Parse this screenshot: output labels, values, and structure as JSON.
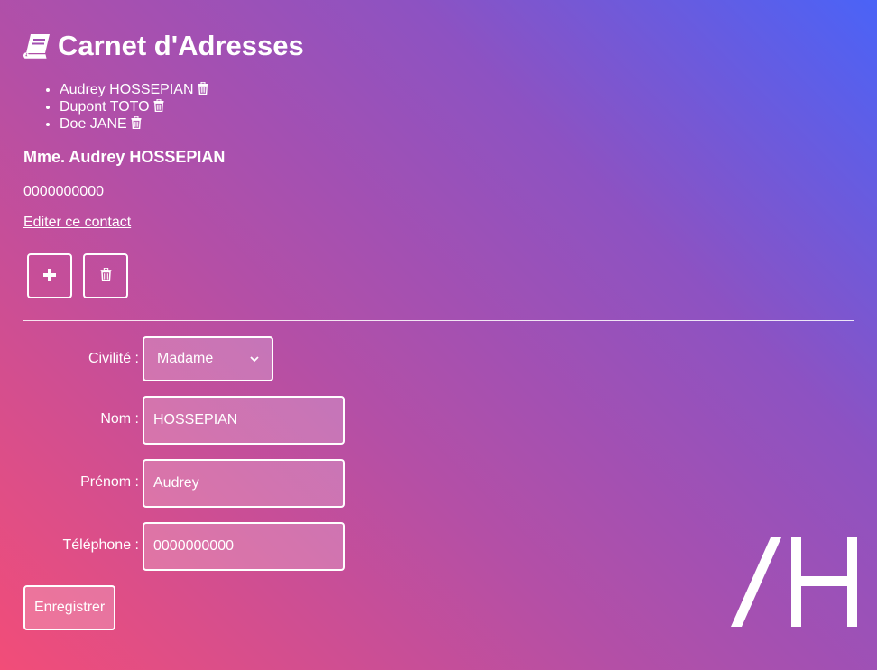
{
  "app": {
    "title": "Carnet d'Adresses",
    "title_icon": "book-icon"
  },
  "contacts": [
    {
      "label": "Audrey HOSSEPIAN",
      "action_icon": "trash-icon"
    },
    {
      "label": "Dupont TOTO",
      "action_icon": "trash-icon"
    },
    {
      "label": "Doe JANE",
      "action_icon": "trash-icon"
    }
  ],
  "selected_contact": {
    "heading": "Mme. Audrey HOSSEPIAN",
    "phone": "0000000000",
    "edit_link": "Editer ce contact"
  },
  "toolbar": {
    "add_icon": "plus-icon",
    "delete_icon": "trash-icon"
  },
  "form": {
    "civilite_label": "Civilité :",
    "civilite_value": "Madame",
    "nom_label": "Nom :",
    "nom_value": "HOSSEPIAN",
    "prenom_label": "Prénom :",
    "prenom_value": "Audrey",
    "telephone_label": "Téléphone :",
    "telephone_value": "0000000000",
    "submit_label": "Enregistrer"
  },
  "logo": {
    "icon": "ah-logo-icon"
  },
  "colors": {
    "gradient_start": "#f24d78",
    "gradient_end": "#4a63f7",
    "text": "#ffffff"
  }
}
